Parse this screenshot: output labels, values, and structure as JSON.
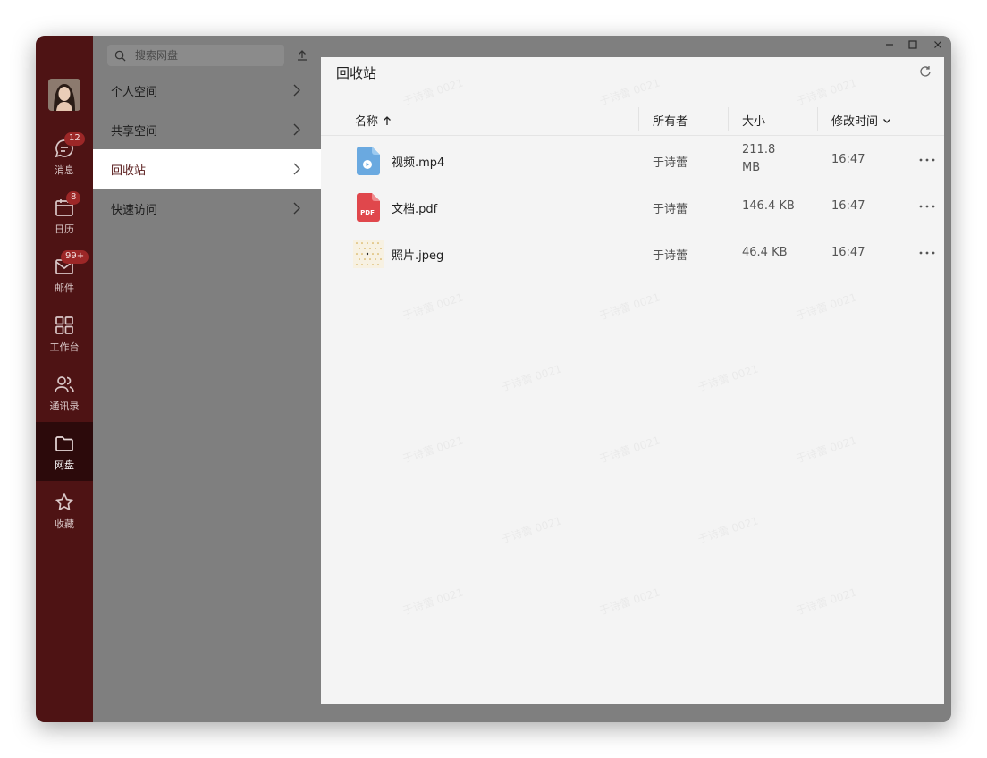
{
  "rail": {
    "items": [
      {
        "label": "消息",
        "icon": "message-icon",
        "badge": "12"
      },
      {
        "label": "日历",
        "icon": "calendar-icon",
        "badge": "8"
      },
      {
        "label": "邮件",
        "icon": "mail-icon",
        "badge": "99+"
      },
      {
        "label": "工作台",
        "icon": "grid-icon",
        "badge": ""
      },
      {
        "label": "通讯录",
        "icon": "contacts-icon",
        "badge": ""
      },
      {
        "label": "网盘",
        "icon": "folder-icon",
        "badge": ""
      },
      {
        "label": "收藏",
        "icon": "star-icon",
        "badge": ""
      }
    ],
    "active": "网盘",
    "colors": {
      "bg": "#4e1314",
      "active_bg": "#2c0a0b",
      "badge": "#9c2727"
    }
  },
  "nav": {
    "search_placeholder": "搜索网盘",
    "items": [
      {
        "label": "个人空间"
      },
      {
        "label": "共享空间"
      },
      {
        "label": "回收站"
      },
      {
        "label": "快速访问"
      }
    ],
    "active": "回收站"
  },
  "main": {
    "title": "回收站",
    "columns": {
      "name": "名称",
      "owner": "所有者",
      "size": "大小",
      "modified": "修改时间"
    },
    "rows": [
      {
        "name": "视频.mp4",
        "type": "video",
        "owner": "于诗蕾",
        "size_line1": "211.8",
        "size_line2": "MB",
        "time": "16:47"
      },
      {
        "name": "文档.pdf",
        "type": "pdf",
        "owner": "于诗蕾",
        "size_line1": "146.4 KB",
        "size_line2": "",
        "time": "16:47"
      },
      {
        "name": "照片.jpeg",
        "type": "image",
        "owner": "于诗蕾",
        "size_line1": "46.4 KB",
        "size_line2": "",
        "time": "16:47"
      }
    ],
    "pdf_badge": "PDF",
    "watermark": "于诗蕾 0021"
  }
}
